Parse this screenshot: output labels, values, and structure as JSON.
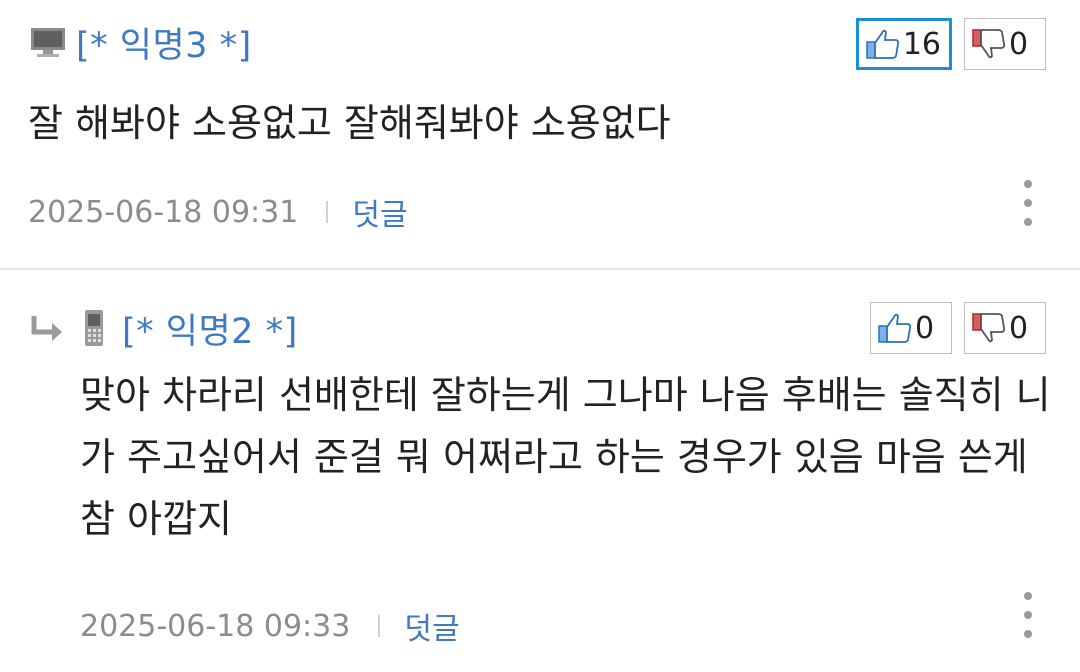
{
  "comments": [
    {
      "author": "[* 익명3 *]",
      "device": "desktop-icon",
      "is_reply": false,
      "text": "잘 해봐야 소용없고 잘해줘봐야 소용없다",
      "upvotes": "16",
      "downvotes": "0",
      "date": "2025-06-18 09:31",
      "reply_label": "덧글"
    },
    {
      "author": "[* 익명2 *]",
      "device": "mobile-phone-icon",
      "is_reply": true,
      "text": "맞아 차라리 선배한테 잘하는게 그나마 나음 후배는 솔직히 니가 주고싶어서 준걸 뭐 어쩌라고 하는 경우가 있음 마음 쓴게 참 아깝지",
      "upvotes": "0",
      "downvotes": "0",
      "date": "2025-06-18 09:33",
      "reply_label": "덧글"
    }
  ],
  "colors": {
    "author": "#3f79c6",
    "active_vote_border": "#1a8fd6",
    "date": "#8c8c8c",
    "divider": "#e6e6e6"
  }
}
